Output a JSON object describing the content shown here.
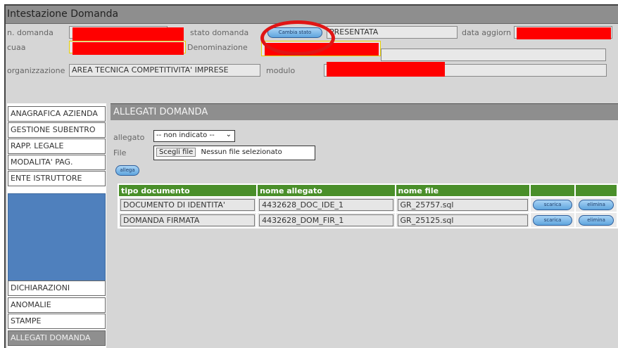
{
  "header": {
    "title": "Intestazione Domanda",
    "labels": {
      "n_domanda": "n. domanda",
      "stato_domanda": "stato domanda",
      "data_aggiorn": "data aggiorn",
      "cuaa": "cuaa",
      "denominazione": "Denominazione",
      "organizzazione": "organizzazione",
      "modulo": "modulo"
    },
    "cambia_stato_label": "Cambia stato",
    "stato_value": "PRESENTATA",
    "organizzazione_value": "AREA TECNICA COMPETITIVITA' IMPRESE"
  },
  "sidebar": {
    "items": [
      {
        "label": "ANAGRAFICA AZIENDA"
      },
      {
        "label": "GESTIONE SUBENTRO"
      },
      {
        "label": "RAPP. LEGALE"
      },
      {
        "label": "MODALITA' PAG."
      },
      {
        "label": "ENTE ISTRUTTORE"
      },
      {
        "label": "DICHIARAZIONI"
      },
      {
        "label": "ANOMALIE"
      },
      {
        "label": "STAMPE"
      },
      {
        "label": "ALLEGATI DOMANDA"
      }
    ]
  },
  "main": {
    "title": "ALLEGATI DOMANDA",
    "allegato_label": "allegato",
    "allegato_selected": "-- non indicato --",
    "file_label": "File",
    "file_button": "Scegli file",
    "file_status": "Nessun file selezionato",
    "allega_button": "allega",
    "table": {
      "headers": [
        "tipo documento",
        "nome allegato",
        "nome file",
        "",
        ""
      ],
      "rows": [
        {
          "tipo": "DOCUMENTO DI IDENTITA'",
          "nome_allegato": "4432628_DOC_IDE_1",
          "nome_file": "GR_25757.sql",
          "scarica": "scarica",
          "elimina": "elimina"
        },
        {
          "tipo": "DOMANDA FIRMATA",
          "nome_allegato": "4432628_DOM_FIR_1",
          "nome_file": "GR_25125.sql",
          "scarica": "scarica",
          "elimina": "elimina"
        }
      ]
    }
  },
  "colors": {
    "redaction": "#ff0000",
    "annotation_circle": "#e01515",
    "table_header": "#4a8f2a",
    "sidebar_block": "#4f80bd",
    "header_bar": "#8e8e8e"
  }
}
